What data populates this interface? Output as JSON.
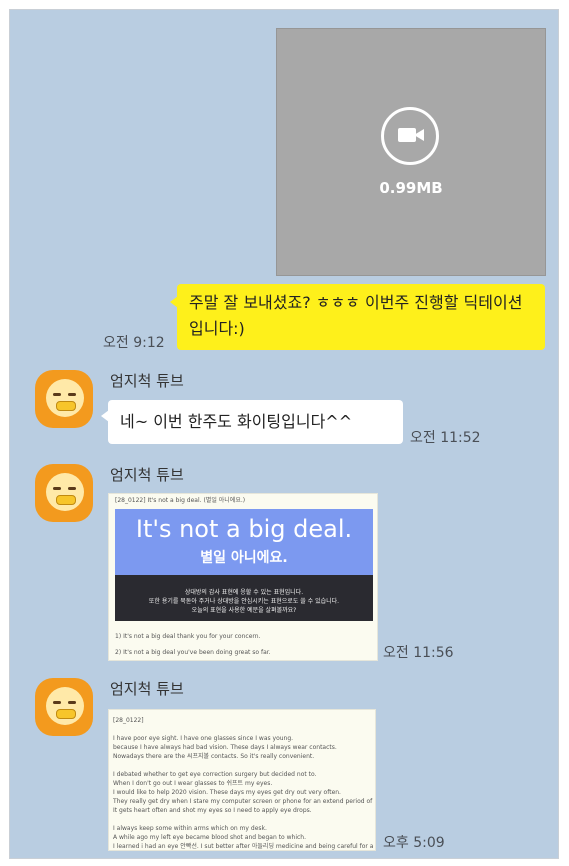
{
  "video_message": {
    "size": "0.99MB",
    "icon": "video-camera-icon"
  },
  "messages": [
    {
      "type": "text",
      "text": "주말 잘 보내셨죠? ㅎㅎㅎ 이번주 진행할 딕테이션입니다:)",
      "time": "오전 9:12"
    },
    {
      "type": "text",
      "sender": "엄지척 튜브",
      "text": "네~ 이번 한주도 화이팅입니다^^",
      "time": "오전 11:52"
    },
    {
      "type": "image",
      "sender": "엄지척 튜브",
      "time": "오전 11:56",
      "image": {
        "header": "[28_0122] It's not a big deal. (별일 아니에요.)",
        "title": "It's not a big deal.",
        "title_kr": "별일 아니에요.",
        "desc": [
          "상대방의 감사 표현에 응할 수 있는 표현입니다.",
          "또한 용기를 북돋아 주거나 상대방을 안심시키는 표현으로도 쓸 수 있습니다.",
          "오늘의 표현을 사용한 예문을 살펴볼까요?"
        ],
        "examples": [
          "1) It's not a big deal thank you for your concern.",
          "2) It's not a big deal you've been doing great so far."
        ]
      }
    },
    {
      "type": "image",
      "sender": "엄지척 튜브",
      "time": "오후 5:09",
      "image": {
        "lines": [
          "[28_0122]",
          "",
          "I have poor eye sight. I have one glasses since I was young.",
          "because I have always had bad vision. These days I always wear contacts.",
          "Nowadays there are the 씨프지볼 contacts. So it's really convenient.",
          "",
          "I debated whether to get eye correction surgery but decided not to.",
          "When I don't go out I wear glasses to 쉬프트 my eyes.",
          "I would like to help 2020 vision. These days my eyes get dry out very often.",
          "They really get dry when I stare my computer screen or phone for an extend period of time.",
          "It gets heart often and shot my eyes so I need to apply eye drops.",
          "",
          "I always keep some within arms which on my desk.",
          "A while ago my left eye became blood shot and began to which.",
          "I learned i had an eye 안빡선. I sut better after 아들리딩 medicine and being careful for a few days."
        ]
      }
    }
  ]
}
